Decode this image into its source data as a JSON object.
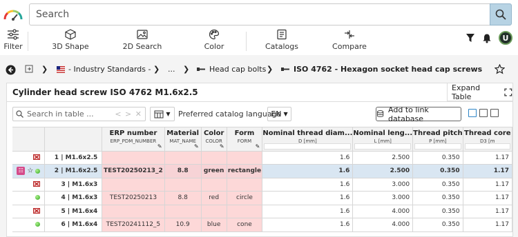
{
  "search": {
    "placeholder": "Search"
  },
  "toolbar": {
    "filter": "Filter",
    "shape3d": "3D Shape",
    "search2d": "2D Search",
    "color": "Color",
    "catalogs": "Catalogs",
    "compare": "Compare"
  },
  "user": {
    "initial": "U"
  },
  "breadcrumb": {
    "industry": "- Industry Standards -",
    "ellipsis": "...",
    "cap_bolts": "Head cap bolts",
    "current": "ISO 4762 - Hexagon socket head cap screws"
  },
  "card": {
    "title": "Cylinder head screw ISO 4762 M1.6x2.5",
    "expand": "Expand Table"
  },
  "table_toolbar": {
    "search_placeholder": "Search in table ...",
    "language_label": "Preferred catalog language",
    "language_value": "EN",
    "add_link": "Add to link database"
  },
  "columns": [
    {
      "title": "ERP number",
      "sub": "ERP_PDM_NUMBER"
    },
    {
      "title": "Material",
      "sub": "MAT_NAME"
    },
    {
      "title": "Color",
      "sub": "COLOR"
    },
    {
      "title": "Form",
      "sub": "FORM"
    },
    {
      "title": "Nominal thread diam...",
      "sub": "D [mm]"
    },
    {
      "title": "Nominal leng...",
      "sub": "L [mm]"
    },
    {
      "title": "Thread pitch",
      "sub": "P [mm]"
    },
    {
      "title": "Thread core",
      "sub": "D3 [m"
    }
  ],
  "rows": [
    {
      "status": "invalid",
      "label": "1 | M1.6x2.5",
      "erp": "",
      "material": "",
      "color": "",
      "form": "",
      "d": "1.6",
      "l": "2.500",
      "p": "0.350",
      "d3": "1.17"
    },
    {
      "status": "valid",
      "label": "2 | M1.6x2.5",
      "erp": "TEST20250213_2",
      "material": "8.8",
      "color": "green",
      "form": "rectangle",
      "d": "1.6",
      "l": "2.500",
      "p": "0.350",
      "d3": "1.17"
    },
    {
      "status": "invalid",
      "label": "3 | M1.6x3",
      "erp": "",
      "material": "",
      "color": "",
      "form": "",
      "d": "1.6",
      "l": "3.000",
      "p": "0.350",
      "d3": "1.17"
    },
    {
      "status": "valid",
      "label": "4 | M1.6x3",
      "erp": "TEST20250213",
      "material": "8.8",
      "color": "red",
      "form": "circle",
      "d": "1.6",
      "l": "3.000",
      "p": "0.350",
      "d3": "1.17"
    },
    {
      "status": "invalid",
      "label": "5 | M1.6x4",
      "erp": "",
      "material": "",
      "color": "",
      "form": "",
      "d": "1.6",
      "l": "4.000",
      "p": "0.350",
      "d3": "1.17"
    },
    {
      "status": "valid",
      "label": "6 | M1.6x4",
      "erp": "TEST20241112_5",
      "material": "10.9",
      "color": "blue",
      "form": "cone",
      "d": "1.6",
      "l": "4.000",
      "p": "0.350",
      "d3": "1.17"
    }
  ],
  "colors": {
    "accent": "#2d84c6",
    "pink_cell": "#fdd8d8",
    "selected_row": "#d9e6f2",
    "cart": "#d54b8a"
  }
}
